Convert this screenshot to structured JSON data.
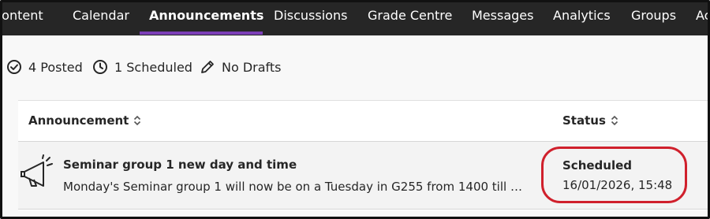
{
  "nav": {
    "tabs": [
      {
        "label": "Content",
        "active": false
      },
      {
        "label": "Calendar",
        "active": false
      },
      {
        "label": "Announcements",
        "active": true
      },
      {
        "label": "Discussions",
        "active": false
      },
      {
        "label": "Grade Centre",
        "active": false
      },
      {
        "label": "Messages",
        "active": false
      },
      {
        "label": "Analytics",
        "active": false
      },
      {
        "label": "Groups",
        "active": false
      },
      {
        "label": "Ac",
        "active": false
      }
    ],
    "accent": "#7c3fb8",
    "background": "#262626"
  },
  "counts": {
    "posted": {
      "label": "4 Posted",
      "icon": "check-circle-icon"
    },
    "scheduled": {
      "label": "1 Scheduled",
      "icon": "clock-icon"
    },
    "drafts": {
      "label": "No Drafts",
      "icon": "pencil-icon"
    }
  },
  "table": {
    "headers": {
      "announcement": "Announcement",
      "status": "Status"
    },
    "rows": [
      {
        "icon": "megaphone-icon",
        "title": "Seminar group 1 new day and time",
        "body": "Monday's Seminar group 1 will now be on a Tuesday in G255 from 1400 till 1...",
        "status": "Scheduled",
        "date": "16/01/2026, 15:48"
      }
    ]
  },
  "highlight_color": "#d0202c"
}
